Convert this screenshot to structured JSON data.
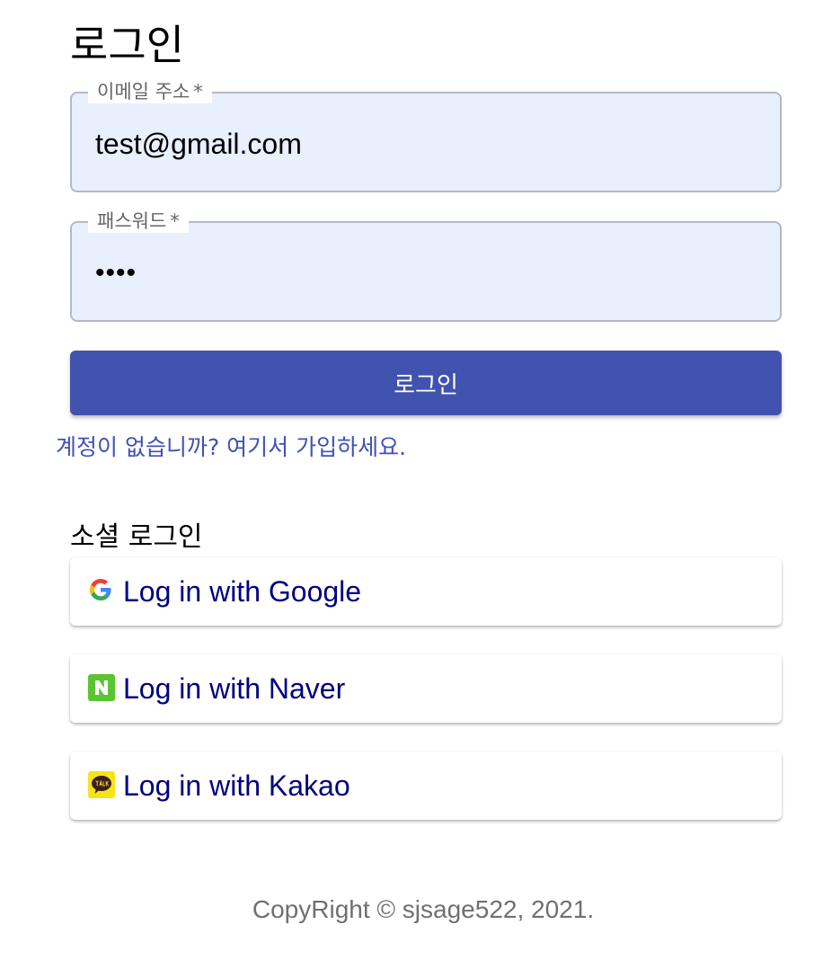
{
  "page": {
    "title": "로그인"
  },
  "form": {
    "email": {
      "label": "이메일 주소",
      "required_marker": "*",
      "value": "test@gmail.com"
    },
    "password": {
      "label": "패스워드",
      "required_marker": "*",
      "value": "1234"
    },
    "submit_label": "로그인",
    "submit_color": "#4153af",
    "signup_link_text": "계정이 없습니까? 여기서 가입하세요."
  },
  "social": {
    "title": "소셜 로그인",
    "buttons": [
      {
        "label": "Log in with Google",
        "icon": "google-icon"
      },
      {
        "label": "Log in with Naver",
        "icon": "naver-icon"
      },
      {
        "label": "Log in with Kakao",
        "icon": "kakao-icon"
      }
    ],
    "label_color": "#000080"
  },
  "footer": {
    "text": "CopyRight © sjsage522, 2021."
  }
}
